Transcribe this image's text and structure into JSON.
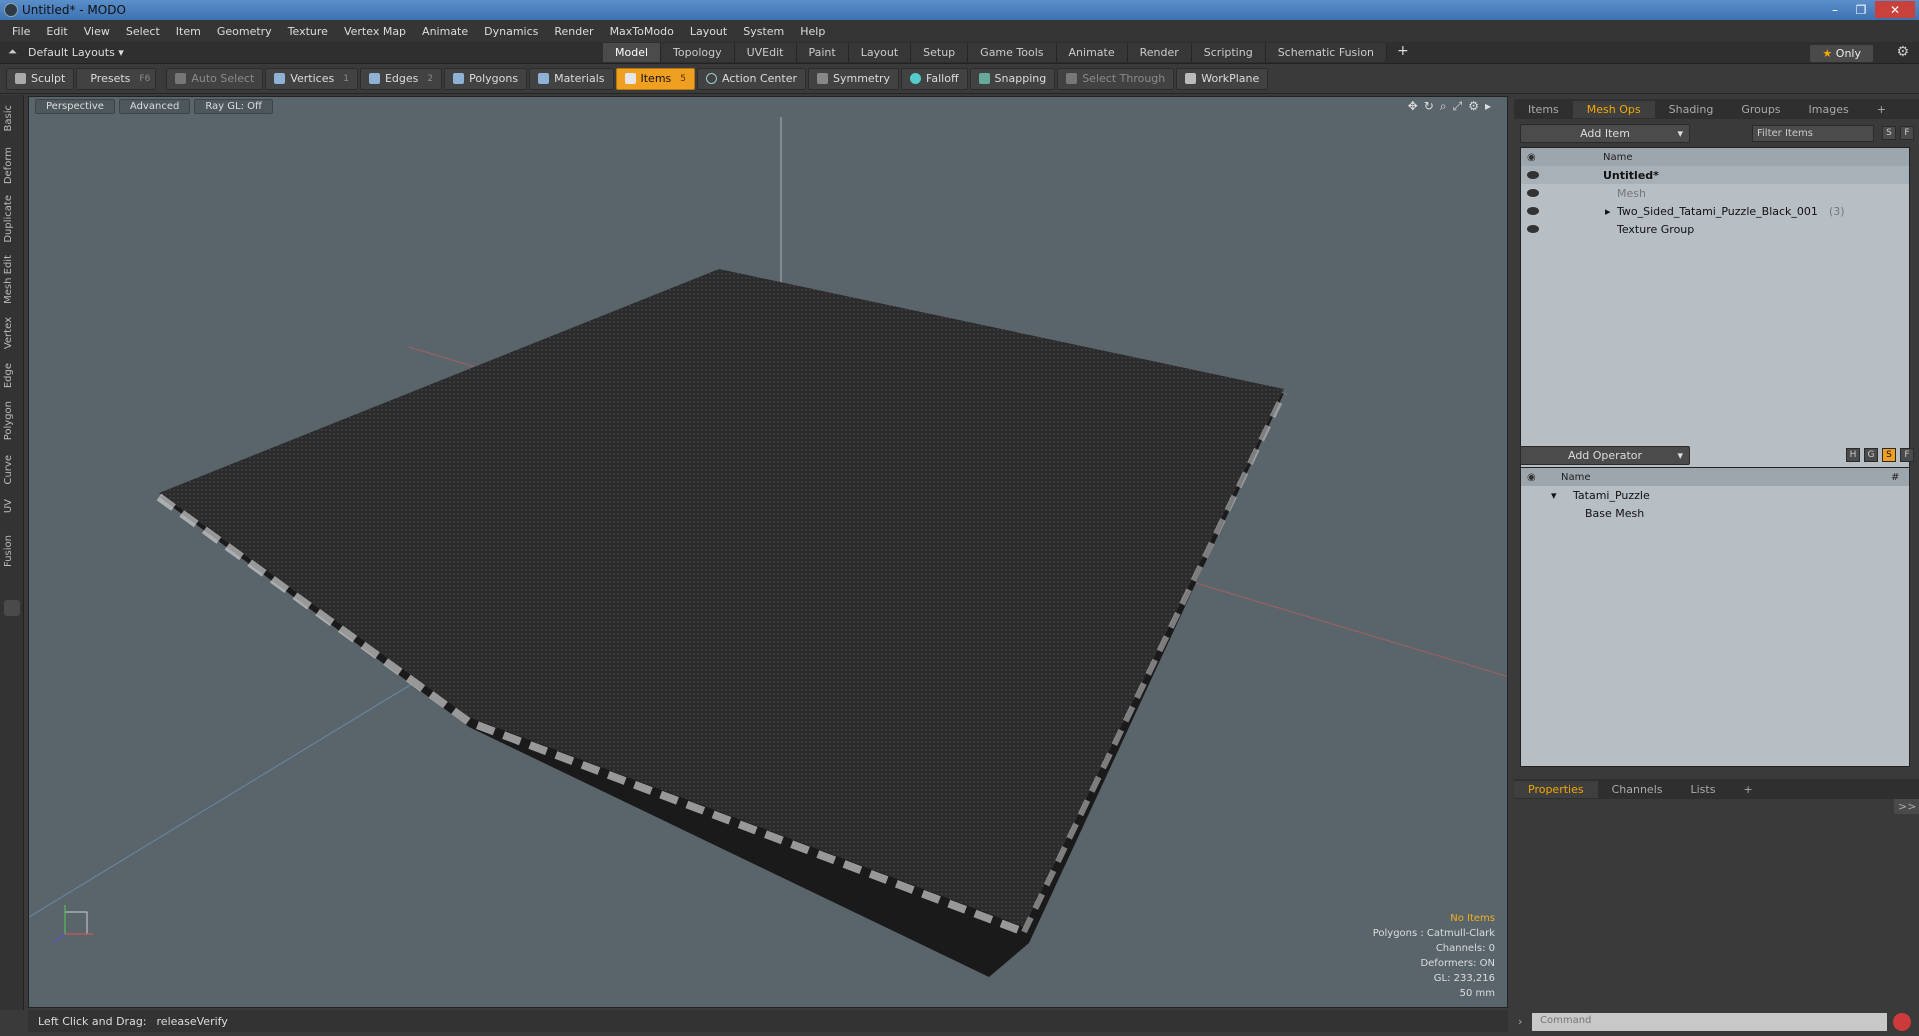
{
  "window": {
    "title": "Untitled* - MODO",
    "controls": [
      "–",
      "❐",
      "✕"
    ]
  },
  "menu": [
    "File",
    "Edit",
    "View",
    "Select",
    "Item",
    "Geometry",
    "Texture",
    "Vertex Map",
    "Animate",
    "Dynamics",
    "Render",
    "MaxToModo",
    "Layout",
    "System",
    "Help"
  ],
  "layoutbar": {
    "layout": "Default Layouts ▾",
    "tabs": [
      "Model",
      "Topology",
      "UVEdit",
      "Paint",
      "Layout",
      "Setup",
      "Game Tools",
      "Animate",
      "Render",
      "Scripting",
      "Schematic Fusion"
    ],
    "active_tab": "Model",
    "plus": "+",
    "only": "Only",
    "star": "★"
  },
  "toolbar": {
    "sculpt": "Sculpt",
    "presets": "Presets",
    "presets_key": "F6",
    "auto_select": "Auto Select",
    "vertices": "Vertices",
    "vertices_key": "1",
    "edges": "Edges",
    "edges_key": "2",
    "polygons": "Polygons",
    "materials": "Materials",
    "items": "Items",
    "items_key": "5",
    "action_center": "Action Center",
    "symmetry": "Symmetry",
    "falloff": "Falloff",
    "snapping": "Snapping",
    "select_through": "Select Through",
    "workplane": "WorkPlane"
  },
  "lefttabs": [
    "Basic",
    "Deform",
    "Duplicate",
    "Mesh Edit",
    "Vertex",
    "Edge",
    "Polygon",
    "Curve",
    "UV",
    "Fusion"
  ],
  "viewport": {
    "view": "Perspective",
    "mode": "Advanced",
    "raygl": "Ray GL: Off",
    "info": {
      "no_items": "No Items",
      "polygons": "Polygons : Catmull-Clark",
      "channels": "Channels: 0",
      "deformers": "Deformers: ON",
      "gl": "GL: 233,216",
      "scale": "50 mm"
    }
  },
  "status": {
    "hint": "Left Click and Drag:",
    "action": "releaseVerify"
  },
  "panel_top": {
    "tabs": [
      "Items",
      "Mesh Ops",
      "Shading",
      "Groups",
      "Images",
      "+"
    ],
    "active": "Mesh Ops",
    "add_item": "Add Item",
    "filter": "Filter Items",
    "s": "S",
    "f": "F",
    "col_name": "Name",
    "rows": [
      {
        "label": "Untitled*",
        "count": ""
      },
      {
        "label": "Mesh",
        "count": ""
      },
      {
        "label": "Two_Sided_Tatami_Puzzle_Black_001",
        "count": "(3)"
      },
      {
        "label": "Texture Group",
        "count": ""
      }
    ]
  },
  "panel_mid": {
    "add_operator": "Add Operator",
    "h": "H",
    "g": "G",
    "s": "S",
    "f": "F",
    "col_name": "Name",
    "col_hash": "#",
    "rows": [
      "Tatami_Puzzle",
      "Base Mesh"
    ]
  },
  "panel_bottom": {
    "tabs": [
      "Properties",
      "Channels",
      "Lists",
      "+"
    ],
    "active": "Properties",
    "expand": ">>",
    "command_placeholder": "Command"
  }
}
